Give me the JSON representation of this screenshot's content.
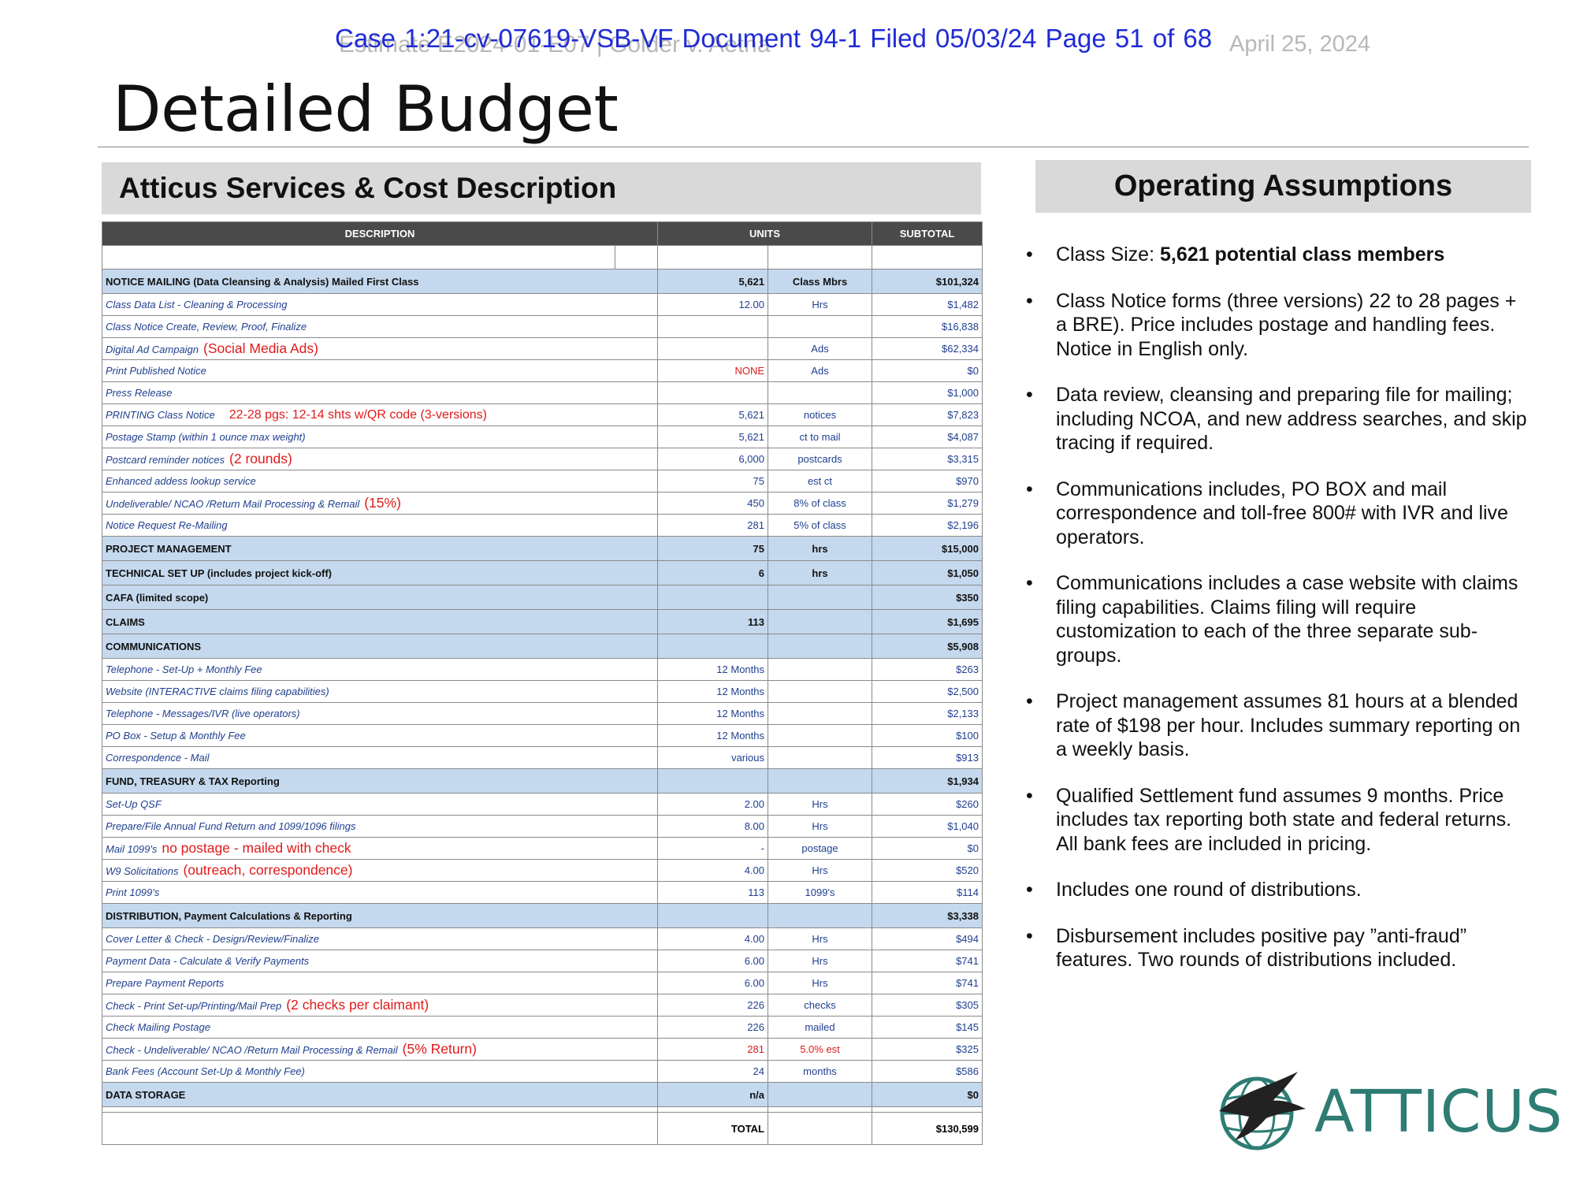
{
  "header": {
    "faint_left": "Estimate E2024-01-E07 | Golder v. Aetna",
    "faint_date": "April 25, 2024",
    "stamp": "Case 1:21-cv-07619-VSB-VF   Document 94-1   Filed 05/03/24   Page 51 of 68",
    "title": "Detailed Budget"
  },
  "left_section_title": "Atticus Services & Cost Description",
  "right_section_title": "Operating Assumptions",
  "table": {
    "headers": {
      "description": "DESCRIPTION",
      "units": "UNITS",
      "subtotal": "SUBTOTAL"
    },
    "rows": [
      {
        "kind": "sec",
        "desc": "NOTICE MAILING (Data Cleansing & Analysis) Mailed First Class",
        "qty": "5,621",
        "unit": "Class Mbrs",
        "sub": "$101,324"
      },
      {
        "kind": "item",
        "desc": "Class Data List - Cleaning & Processing",
        "qty": "12.00",
        "unit": "Hrs",
        "sub": "$1,482"
      },
      {
        "kind": "item",
        "desc": "Class Notice Create, Review, Proof, Finalize",
        "qty": "",
        "unit": "",
        "sub": "$16,838"
      },
      {
        "kind": "item",
        "desc": "Digital Ad Campaign",
        "note": "(Social Media Ads)",
        "qty": "",
        "unit": "Ads",
        "sub": "$62,334"
      },
      {
        "kind": "item",
        "desc": "Print Published Notice",
        "qty": "NONE",
        "qty_red": true,
        "unit": "Ads",
        "sub": "$0"
      },
      {
        "kind": "item",
        "desc": "Press Release",
        "qty": "",
        "unit": "",
        "sub": "$1,000"
      },
      {
        "kind": "item",
        "desc": "PRINTING Class Notice",
        "note_sm": "22-28 pgs: 12-14 shts w/QR code (3-versions)",
        "qty": "5,621",
        "unit": "notices",
        "sub": "$7,823"
      },
      {
        "kind": "item",
        "desc": "Postage Stamp (within 1 ounce max weight)",
        "qty": "5,621",
        "unit": "ct to mail",
        "sub": "$4,087"
      },
      {
        "kind": "item",
        "desc": "Postcard reminder notices",
        "note": "(2 rounds)",
        "qty": "6,000",
        "unit": "postcards",
        "sub": "$3,315"
      },
      {
        "kind": "item",
        "desc": "Enhanced addess lookup service",
        "qty": "75",
        "unit": "est ct",
        "sub": "$970"
      },
      {
        "kind": "item",
        "desc": "Undeliverable/ NCAO /Return Mail Processing & Remail",
        "note": "(15%)",
        "qty": "450",
        "unit": "8% of class",
        "sub": "$1,279"
      },
      {
        "kind": "item",
        "desc": "Notice Request Re-Mailing",
        "qty": "281",
        "unit": "5% of class",
        "sub": "$2,196"
      },
      {
        "kind": "sec",
        "desc": "PROJECT MANAGEMENT",
        "qty": "75",
        "unit": "hrs",
        "sub": "$15,000"
      },
      {
        "kind": "sec",
        "desc": "TECHNICAL SET UP (includes project kick-off)",
        "qty": "6",
        "unit": "hrs",
        "sub": "$1,050"
      },
      {
        "kind": "sec",
        "desc": "CAFA (limited scope)",
        "qty": "",
        "unit": "",
        "sub": "$350"
      },
      {
        "kind": "sec",
        "desc": "CLAIMS",
        "qty": "113",
        "unit": "",
        "sub": "$1,695"
      },
      {
        "kind": "sec",
        "desc": "COMMUNICATIONS",
        "qty": "",
        "unit": "",
        "sub": "$5,908"
      },
      {
        "kind": "item",
        "ind": true,
        "desc": "Telephone - Set-Up + Monthly Fee",
        "qty": "12 Months",
        "unit": "",
        "sub": "$263"
      },
      {
        "kind": "item",
        "ind": true,
        "desc": "Website (INTERACTIVE claims filing capabilities)",
        "qty": "12 Months",
        "unit": "",
        "sub": "$2,500"
      },
      {
        "kind": "item",
        "ind": true,
        "desc": "Telephone - Messages/IVR (live operators)",
        "qty": "12 Months",
        "unit": "",
        "sub": "$2,133"
      },
      {
        "kind": "item",
        "ind": true,
        "desc": "PO Box - Setup & Monthly Fee",
        "qty": "12 Months",
        "unit": "",
        "sub": "$100"
      },
      {
        "kind": "item",
        "ind": true,
        "desc": "Correspondence - Mail",
        "qty": "various",
        "unit": "",
        "sub": "$913"
      },
      {
        "kind": "sec",
        "desc": "FUND, TREASURY & TAX Reporting",
        "qty": "",
        "unit": "",
        "sub": "$1,934"
      },
      {
        "kind": "item",
        "ind": true,
        "desc": "Set-Up QSF",
        "qty": "2.00",
        "unit": "Hrs",
        "sub": "$260"
      },
      {
        "kind": "item",
        "ind": true,
        "desc": "Prepare/File Annual Fund Return and 1099/1096 filings",
        "qty": "8.00",
        "unit": "Hrs",
        "sub": "$1,040"
      },
      {
        "kind": "item",
        "ind": true,
        "desc": "Mail  1099's",
        "note": "no postage - mailed with check",
        "qty": "-",
        "unit": "postage",
        "sub": "$0"
      },
      {
        "kind": "item",
        "ind": true,
        "desc": "W9 Solicitations",
        "note": "(outreach, correspondence)",
        "qty": "4.00",
        "unit": "Hrs",
        "sub": "$520"
      },
      {
        "kind": "item",
        "ind": true,
        "desc": "Print  1099's",
        "qty": "113",
        "unit": "1099's",
        "sub": "$114"
      },
      {
        "kind": "sec",
        "desc": "DISTRIBUTION, Payment Calculations & Reporting",
        "qty": "",
        "unit": "",
        "sub": "$3,338"
      },
      {
        "kind": "item",
        "ind": true,
        "desc": "Cover Letter & Check - Design/Review/Finalize",
        "qty": "4.00",
        "unit": "Hrs",
        "sub": "$494"
      },
      {
        "kind": "item",
        "ind": true,
        "desc": "Payment Data - Calculate & Verify Payments",
        "qty": "6.00",
        "unit": "Hrs",
        "sub": "$741"
      },
      {
        "kind": "item",
        "ind": true,
        "desc": "Prepare Payment Reports",
        "qty": "6.00",
        "unit": "Hrs",
        "sub": "$741"
      },
      {
        "kind": "item",
        "ind": true,
        "desc": "Check - Print Set-up/Printing/Mail Prep",
        "note": "(2 checks per claimant)",
        "qty": "226",
        "unit": "checks",
        "sub": "$305"
      },
      {
        "kind": "item",
        "ind": true,
        "desc": "Check Mailing Postage",
        "qty": "226",
        "unit": "mailed",
        "sub": "$145"
      },
      {
        "kind": "item",
        "ind": true,
        "desc": "Check - Undeliverable/ NCAO /Return Mail Processing & Remail",
        "note": "(5% Return)",
        "qty": "281",
        "qty_red": true,
        "unit": "5.0% est",
        "unit_red": true,
        "sub": "$325"
      },
      {
        "kind": "item",
        "ind": true,
        "desc": "Bank Fees (Account Set-Up & Monthly Fee)",
        "qty": "24",
        "unit": "months",
        "sub": "$586"
      },
      {
        "kind": "sec",
        "desc": "DATA STORAGE",
        "qty": "n/a",
        "unit": "",
        "sub": "$0"
      }
    ],
    "total_label": "TOTAL",
    "total_value": "$130,599"
  },
  "assumptions": [
    {
      "pre": "Class Size: ",
      "bold": "5,621 potential class members",
      "post": ""
    },
    {
      "pre": "Class Notice forms (three versions) 22 to 28 pages + a BRE). Price includes postage and handling fees. Notice in English only.",
      "bold": "",
      "post": ""
    },
    {
      "pre": "Data review, cleansing and preparing file for mailing; including NCOA, and new address searches, and skip tracing if required.",
      "bold": "",
      "post": ""
    },
    {
      "pre": "Communications includes, PO BOX and mail correspondence and toll-free 800# with IVR and live operators.",
      "bold": "",
      "post": ""
    },
    {
      "pre": "Communications includes a case website with claims filing capabilities.  Claims filing will require customization to each of the three separate sub-groups.",
      "bold": "",
      "post": ""
    },
    {
      "pre": "Project management assumes 81 hours at a blended rate of $198 per hour. Includes summary reporting on a weekly basis.",
      "bold": "",
      "post": ""
    },
    {
      "pre": "Qualified Settlement fund assumes 9 months. Price includes tax reporting both state and federal returns. All bank fees are included in pricing.",
      "bold": "",
      "post": ""
    },
    {
      "pre": "Includes one round of distributions.",
      "bold": "",
      "post": ""
    },
    {
      "pre": "Disbursement includes positive pay ”anti-fraud” features.  Two rounds of distributions included.",
      "bold": "",
      "post": ""
    }
  ],
  "bullet_glyph": "•",
  "logo": {
    "text": "ATTICUS",
    "color": "#2e7d74"
  }
}
